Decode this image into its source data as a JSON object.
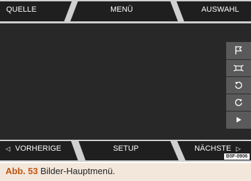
{
  "top_tabs": {
    "left": "QUELLE",
    "center": "MENÜ",
    "right": "AUSWAHL"
  },
  "bottom_tabs": {
    "left": "VORHERIGE",
    "center": "SETUP",
    "right": "NÄCHSTE"
  },
  "side_buttons": [
    {
      "icon": "flag-icon"
    },
    {
      "icon": "fit-screen-icon"
    },
    {
      "icon": "rotate-left-icon"
    },
    {
      "icon": "rotate-right-icon"
    },
    {
      "icon": "play-icon"
    }
  ],
  "image_code": "B5F-0906",
  "caption": {
    "number": "Abb. 53",
    "text": "Bilder-Hauptmenü."
  },
  "colors": {
    "screen_bg": "#282828",
    "bar_bg": "#d0d0d0",
    "tab_dark": "#1f1f1f",
    "side_panel": "#5a5a5a",
    "caption_bg": "#f3e7dc",
    "caption_accent": "#c0540f"
  }
}
